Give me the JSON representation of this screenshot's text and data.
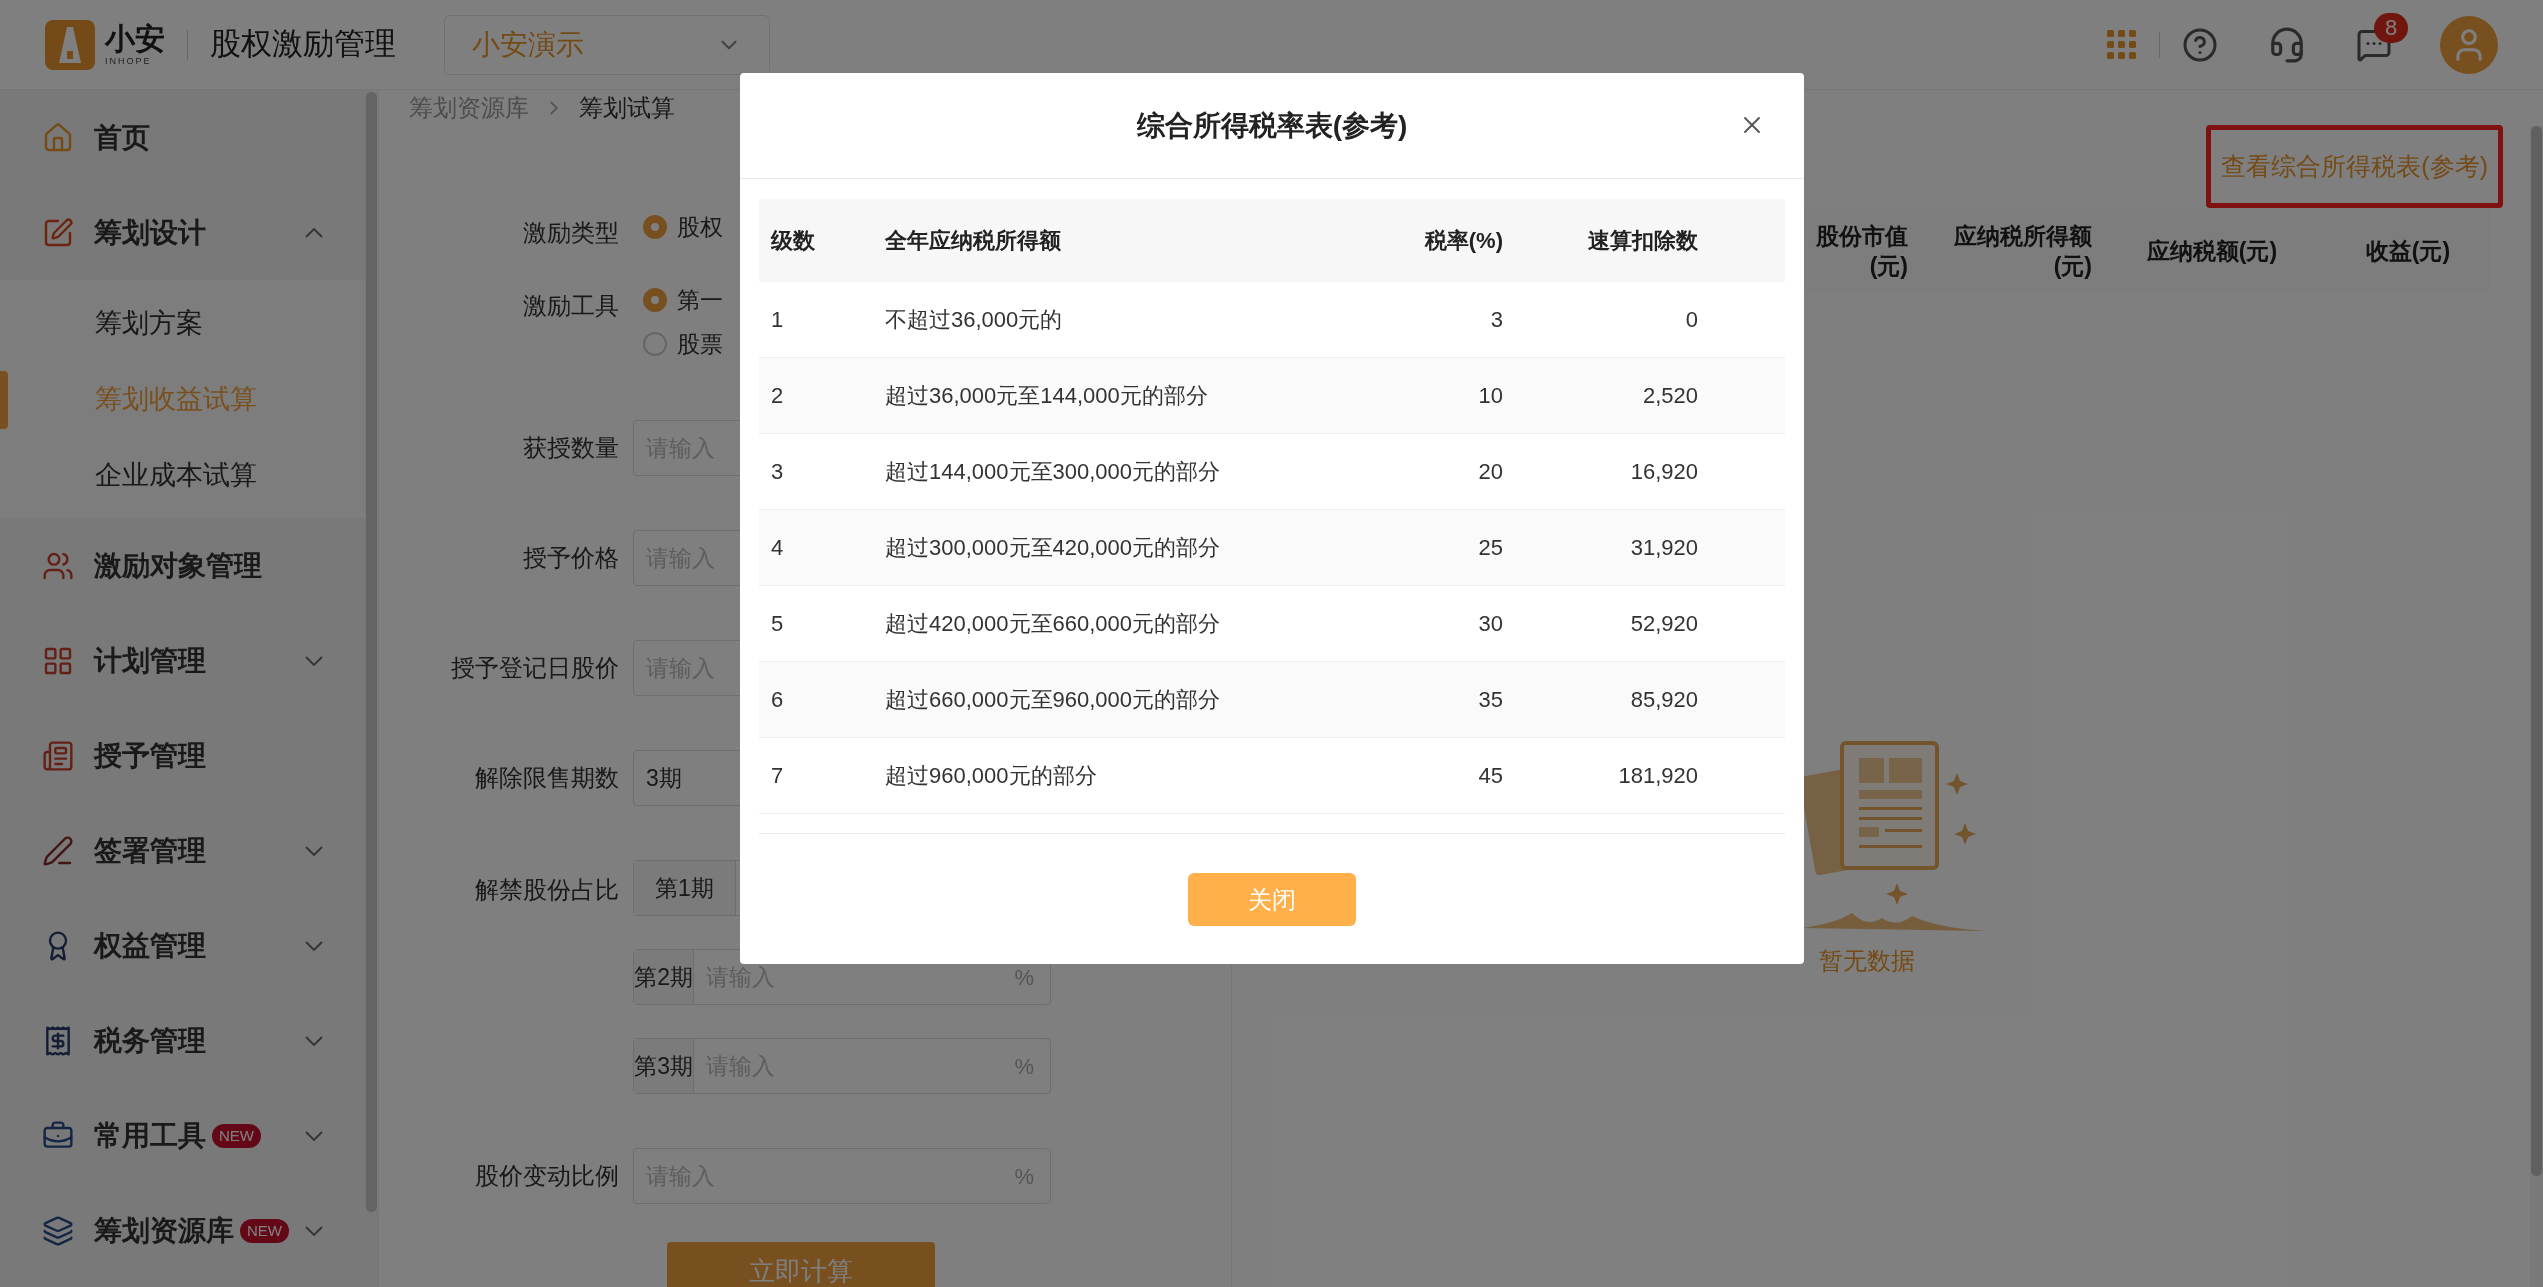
{
  "header": {
    "logo_text": "小安",
    "logo_subtext": "INHOPE",
    "app_title": "股权激励管理",
    "company_select": "小安演示",
    "notification_count": "8"
  },
  "sidebar": {
    "items": [
      {
        "label": "首页"
      },
      {
        "label": "筹划设计",
        "expanded": true,
        "children": [
          {
            "label": "筹划方案",
            "selected": false
          },
          {
            "label": "筹划收益试算",
            "selected": true
          },
          {
            "label": "企业成本试算",
            "selected": false
          }
        ]
      },
      {
        "label": "激励对象管理"
      },
      {
        "label": "计划管理",
        "expanded": false
      },
      {
        "label": "授予管理"
      },
      {
        "label": "签署管理",
        "expanded": false
      },
      {
        "label": "权益管理",
        "expanded": false
      },
      {
        "label": "税务管理",
        "expanded": false
      },
      {
        "label": "常用工具",
        "expanded": false,
        "badge": "NEW"
      },
      {
        "label": "筹划资源库",
        "expanded": false,
        "badge": "NEW"
      }
    ]
  },
  "breadcrumb": [
    "筹划资源库",
    "筹划试算"
  ],
  "form": {
    "fields": [
      {
        "label": "激励类型",
        "kind": "radio",
        "options": [
          {
            "label": "股权",
            "selected": true
          }
        ]
      },
      {
        "label": "激励工具",
        "kind": "radio",
        "options": [
          {
            "label": "第一",
            "selected": true
          },
          {
            "label": "股票",
            "selected": false
          }
        ]
      },
      {
        "label": "获授数量",
        "kind": "input",
        "placeholder": "请输入"
      },
      {
        "label": "授予价格",
        "kind": "input",
        "placeholder": "请输入"
      },
      {
        "label": "授予登记日股价",
        "kind": "input",
        "placeholder": "请输入"
      },
      {
        "label": "解除限售期数",
        "kind": "select",
        "value": "3期"
      },
      {
        "label": "解禁股份占比",
        "kind": "periods",
        "periods": [
          {
            "label": "第1期"
          },
          {
            "label": "第2期",
            "placeholder": "请输入",
            "unit": "%"
          },
          {
            "label": "第3期",
            "placeholder": "请输入",
            "unit": "%"
          }
        ]
      },
      {
        "label": "股价变动比例",
        "kind": "input",
        "placeholder": "请输入",
        "unit": "%"
      }
    ],
    "calculate_button": "立即计算"
  },
  "results": {
    "link": "查看综合所得税表(参考)",
    "columns": [
      [
        "股份市值",
        "(元)"
      ],
      [
        "应纳税所得额",
        "(元)"
      ],
      [
        "应纳税额(元)"
      ],
      [
        "收益(元)"
      ]
    ],
    "empty_text": "暂无数据"
  },
  "modal": {
    "title": "综合所得税率表(参考)",
    "columns": [
      "级数",
      "全年应纳税所得额",
      "税率(%)",
      "速算扣除数"
    ],
    "rows": [
      [
        "1",
        "不超过36,000元的",
        "3",
        "0"
      ],
      [
        "2",
        "超过36,000元至144,000元的部分",
        "10",
        "2,520"
      ],
      [
        "3",
        "超过144,000元至300,000元的部分",
        "20",
        "16,920"
      ],
      [
        "4",
        "超过300,000元至420,000元的部分",
        "25",
        "31,920"
      ],
      [
        "5",
        "超过420,000元至660,000元的部分",
        "30",
        "52,920"
      ],
      [
        "6",
        "超过660,000元至960,000元的部分",
        "35",
        "85,920"
      ],
      [
        "7",
        "超过960,000元的部分",
        "45",
        "181,920"
      ]
    ],
    "close_button": "关闭"
  }
}
